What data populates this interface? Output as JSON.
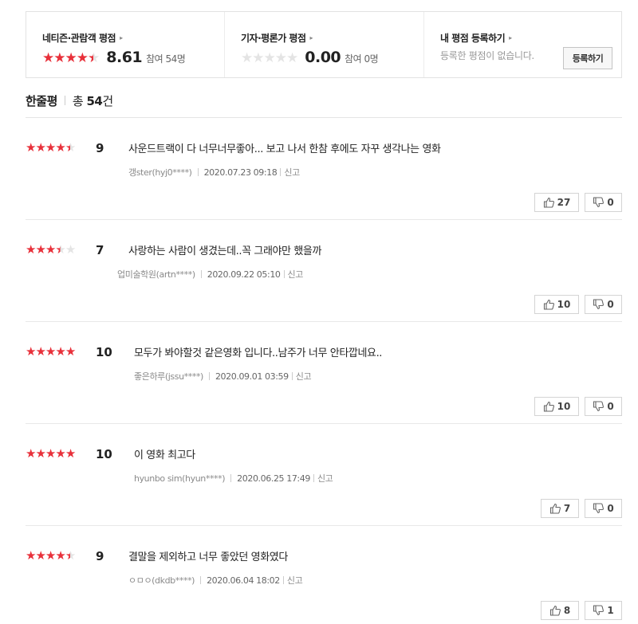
{
  "summary": {
    "audience": {
      "title": "네티즌·관람객 평점",
      "arrow": "▸",
      "stars_filled": 4.5,
      "score": "8.61",
      "participants": "참여 54명"
    },
    "critics": {
      "title": "기자·평론가 평점",
      "arrow": "▸",
      "stars_filled": 0,
      "score": "0.00",
      "participants": "참여 0명"
    },
    "mine": {
      "title": "내 평점 등록하기",
      "arrow": "▸",
      "empty_text": "등록한 평점이 없습니다.",
      "button_label": "등록하기"
    }
  },
  "header": {
    "title": "한줄평",
    "count_prefix": "총",
    "count": "54",
    "count_suffix": "건"
  },
  "colors": {
    "star_on": "#e8303a",
    "star_off": "#e4e4e4"
  },
  "reviews": [
    {
      "stars": 4.5,
      "score": "9",
      "text": "사운드트랙이 다 너무너무좋아... 보고 나서 한참 후에도 자꾸 생각나는 영화",
      "author": "갱ster(hyj0****)",
      "date": "2020.07.23 09:18",
      "report": "신고",
      "likes": "27",
      "dislikes": "0"
    },
    {
      "stars": 3.5,
      "score": "7",
      "text": "사랑하는 사람이 생겼는데..꼭 그래야만 했을까",
      "author": "업미술학원(artn****)",
      "date": "2020.09.22 05:10",
      "report": "신고",
      "likes": "10",
      "dislikes": "0"
    },
    {
      "stars": 5,
      "score": "10",
      "text": "모두가 봐야할것 같은영화 입니다..남주가 너무 안타깝네요..",
      "author": "좋은하루(jssu****)",
      "date": "2020.09.01 03:59",
      "report": "신고",
      "likes": "10",
      "dislikes": "0"
    },
    {
      "stars": 5,
      "score": "10",
      "text": "이 영화 최고다",
      "author": "hyunbo sim(hyun****)",
      "date": "2020.06.25 17:49",
      "report": "신고",
      "likes": "7",
      "dislikes": "0"
    },
    {
      "stars": 4.5,
      "score": "9",
      "text": "결말을 제외하고 너무 좋았던 영화였다",
      "author": "ㅇㅁㅇ(dkdb****)",
      "date": "2020.06.04 18:02",
      "report": "신고",
      "likes": "8",
      "dislikes": "1"
    }
  ]
}
